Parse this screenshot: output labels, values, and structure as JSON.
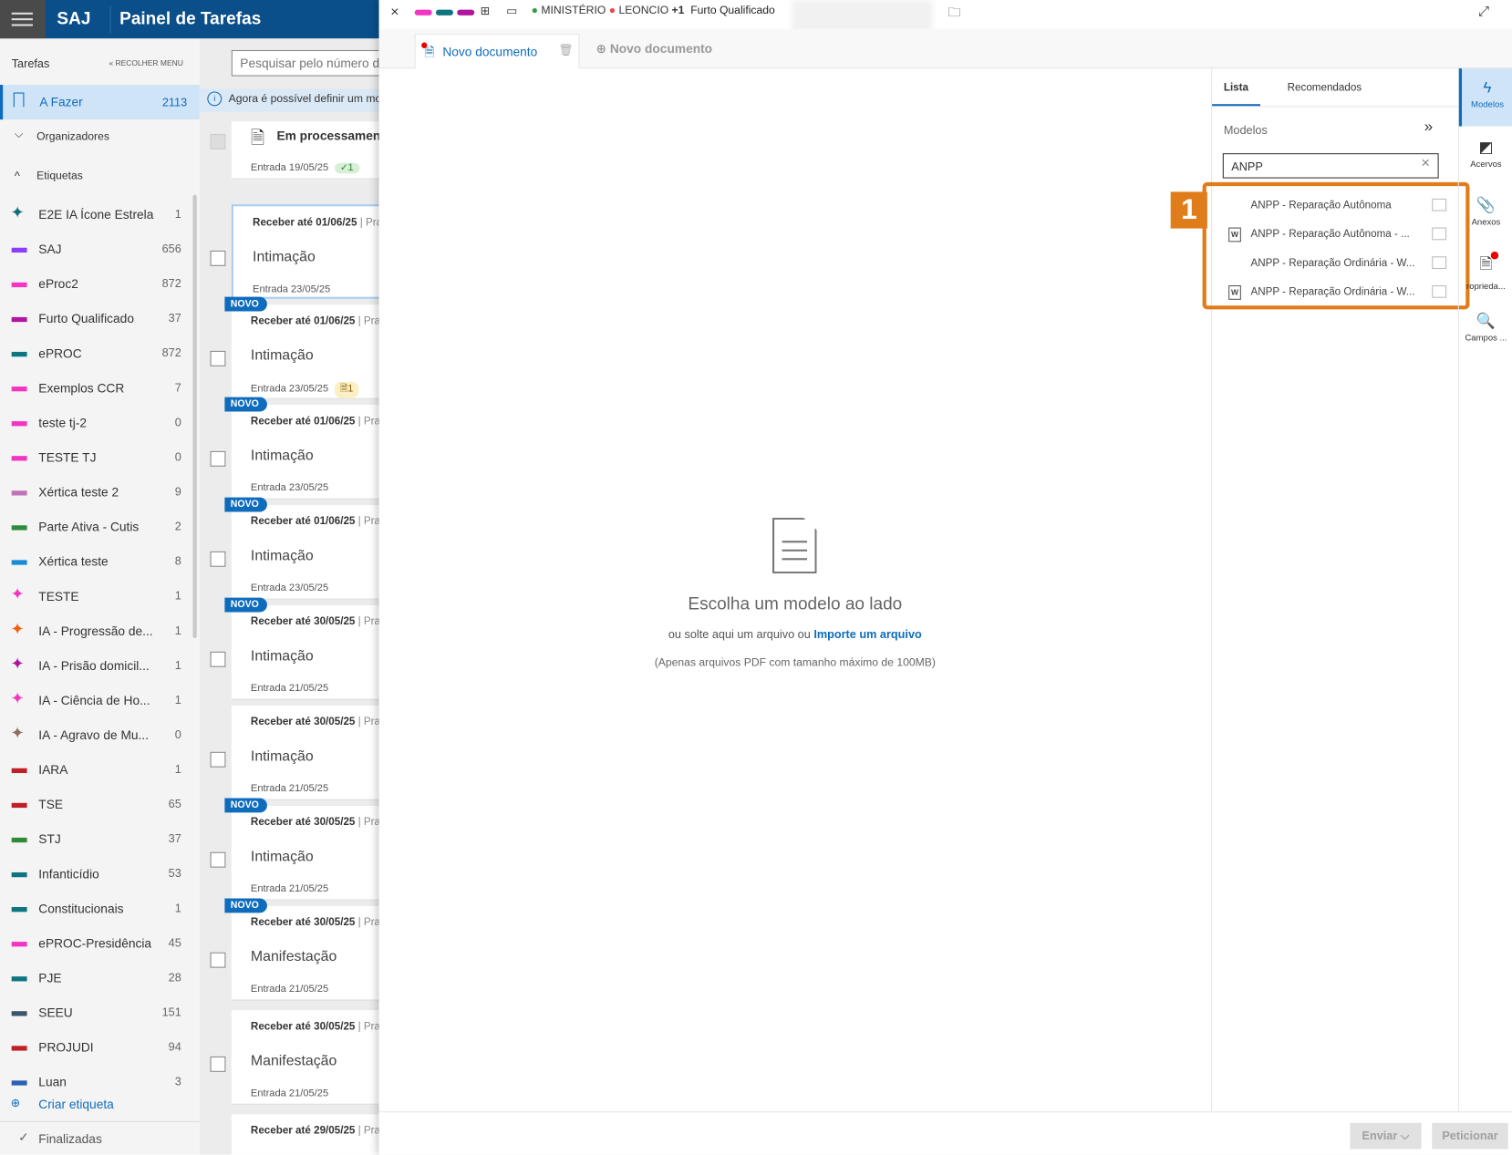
{
  "header": {
    "brand": "SAJ",
    "title": "Painel de Tarefas"
  },
  "sidebar": {
    "section": "Tarefas",
    "collapse": "RECOLHER MENU",
    "active": {
      "label": "A Fazer",
      "count": "2113"
    },
    "organizers": "Organizadores",
    "tags_header": "Etiquetas",
    "tags": [
      {
        "name": "E2E IA Ícone Estrela",
        "count": "1",
        "type": "star",
        "color": "#0e6e7a"
      },
      {
        "name": "SAJ",
        "count": "656",
        "type": "bar",
        "color": "#8a3ffc"
      },
      {
        "name": "eProc2",
        "count": "872",
        "type": "bar",
        "color": "#f236c2"
      },
      {
        "name": "Furto Qualificado",
        "count": "37",
        "type": "bar",
        "color": "#b0169e"
      },
      {
        "name": "ePROC",
        "count": "872",
        "type": "bar",
        "color": "#0e7580"
      },
      {
        "name": "Exemplos CCR",
        "count": "7",
        "type": "bar",
        "color": "#f236c2"
      },
      {
        "name": "teste tj-2",
        "count": "0",
        "type": "bar",
        "color": "#f236c2"
      },
      {
        "name": "TESTE TJ",
        "count": "0",
        "type": "bar",
        "color": "#f236c2"
      },
      {
        "name": "Xértica teste 2",
        "count": "9",
        "type": "bar",
        "color": "#c273b8"
      },
      {
        "name": "Parte Ativa - Cutis",
        "count": "2",
        "type": "bar",
        "color": "#2e8b3a"
      },
      {
        "name": "Xértica teste",
        "count": "8",
        "type": "bar",
        "color": "#1a8ad6"
      },
      {
        "name": "TESTE",
        "count": "1",
        "type": "star",
        "color": "#f236c2"
      },
      {
        "name": "IA - Progressão de...",
        "count": "1",
        "type": "star",
        "color": "#f2600c"
      },
      {
        "name": "IA - Prisão domicil...",
        "count": "1",
        "type": "star",
        "color": "#b0169e"
      },
      {
        "name": "IA - Ciência de Ho...",
        "count": "1",
        "type": "star",
        "color": "#f236c2"
      },
      {
        "name": "IA - Agravo de Mu...",
        "count": "0",
        "type": "star",
        "color": "#8d6e63"
      },
      {
        "name": "IARA",
        "count": "1",
        "type": "bar",
        "color": "#c01f28"
      },
      {
        "name": "TSE",
        "count": "65",
        "type": "bar",
        "color": "#c01f28"
      },
      {
        "name": "STJ",
        "count": "37",
        "type": "bar",
        "color": "#2e8b3a"
      },
      {
        "name": "Infanticídio",
        "count": "53",
        "type": "bar",
        "color": "#0e7580"
      },
      {
        "name": "Constitucionais",
        "count": "1",
        "type": "bar",
        "color": "#0e7580"
      },
      {
        "name": "ePROC-Presidência",
        "count": "45",
        "type": "bar",
        "color": "#f236c2"
      },
      {
        "name": "PJE",
        "count": "28",
        "type": "bar",
        "color": "#0e7580"
      },
      {
        "name": "SEEU",
        "count": "151",
        "type": "bar",
        "color": "#3b556b"
      },
      {
        "name": "PROJUDI",
        "count": "94",
        "type": "bar",
        "color": "#c01f28"
      },
      {
        "name": "Luan",
        "count": "3",
        "type": "bar",
        "color": "#2b5fb4"
      }
    ],
    "create_tag": "Criar etiqueta",
    "finished": "Finalizadas"
  },
  "tasks": {
    "search_placeholder": "Pesquisar pelo número do processo",
    "banner": "Agora é possível definir um modelo",
    "processing": {
      "title": "Em processamento",
      "entry": "Entrada 19/05/25",
      "badge": "✓1"
    },
    "prazo": "Praz",
    "cards": [
      {
        "due": "Receber até 01/06/25",
        "title": "Intimação",
        "entry": "Entrada 23/05/25",
        "novo": false,
        "badge": ""
      },
      {
        "due": "Receber até 01/06/25",
        "title": "Intimação",
        "entry": "Entrada 23/05/25",
        "novo": true,
        "badge": "1"
      },
      {
        "due": "Receber até 01/06/25",
        "title": "Intimação",
        "entry": "Entrada 23/05/25",
        "novo": true,
        "badge": ""
      },
      {
        "due": "Receber até 01/06/25",
        "title": "Intimação",
        "entry": "Entrada 23/05/25",
        "novo": true,
        "badge": ""
      },
      {
        "due": "Receber até 30/05/25",
        "title": "Intimação",
        "entry": "Entrada 21/05/25",
        "novo": true,
        "badge": ""
      },
      {
        "due": "Receber até 30/05/25",
        "title": "Intimação",
        "entry": "Entrada 21/05/25",
        "novo": false,
        "badge": ""
      },
      {
        "due": "Receber até 30/05/25",
        "title": "Intimação",
        "entry": "Entrada 21/05/25",
        "novo": true,
        "badge": ""
      },
      {
        "due": "Receber até 30/05/25",
        "title": "Manifestação",
        "entry": "Entrada 21/05/25",
        "novo": true,
        "badge": ""
      },
      {
        "due": "Receber até 30/05/25",
        "title": "Manifestação",
        "entry": "Entrada 21/05/25",
        "novo": false,
        "badge": ""
      },
      {
        "due": "Receber até 29/05/25",
        "title": "",
        "entry": "",
        "novo": false,
        "badge": ""
      }
    ],
    "novo_label": "NOVO"
  },
  "editor": {
    "topbar": {
      "tag_colors": [
        "#f236c2",
        "#0e7580",
        "#b0169e"
      ],
      "party1": "MINISTÉRIO",
      "party2": "LEONCIO",
      "more": "+1",
      "subject": "Furto Qualificado"
    },
    "tabs": [
      {
        "label": "Novo documento",
        "active": true
      },
      {
        "label": "Novo documento",
        "active": false
      }
    ],
    "empty": {
      "title": "Escolha um modelo ao lado",
      "line_prefix": "ou solte aqui um arquivo ou",
      "link": "Importe um arquivo",
      "note": "(Apenas arquivos PDF com tamanho máximo de 100MB)"
    },
    "models": {
      "tabs": [
        "Lista",
        "Recomendados"
      ],
      "heading": "Modelos",
      "search_value": "ANPP",
      "callout": "1",
      "accent": "#e07c1a",
      "results": [
        {
          "name": "ANPP - Reparação Autônoma",
          "word": false
        },
        {
          "name": "ANPP - Reparação Autônoma - ...",
          "word": true
        },
        {
          "name": "ANPP - Reparação Ordinária - W...",
          "word": false
        },
        {
          "name": "ANPP - Reparação Ordinária - W...",
          "word": true
        }
      ]
    },
    "rail": [
      {
        "label": "Modelos",
        "icon": "lightning-icon"
      },
      {
        "label": "Acervos",
        "icon": "folder-icon"
      },
      {
        "label": "Anexos",
        "icon": "paperclip-icon"
      },
      {
        "label": "Propriedades",
        "short": "roprieda...",
        "icon": "properties-icon"
      },
      {
        "label": "Campos ...",
        "icon": "search-document-icon"
      }
    ],
    "buttons": {
      "send": "Enviar",
      "petition": "Peticionar"
    }
  }
}
